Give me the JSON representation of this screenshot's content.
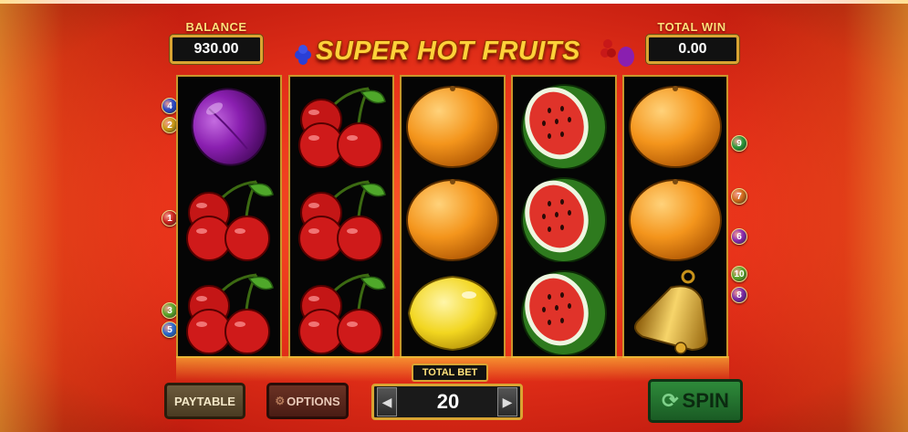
{
  "hud": {
    "balance_label": "BALANCE",
    "balance_value": "930.00",
    "total_win_label": "TOTAL WIN",
    "total_win_value": "0.00"
  },
  "logo": {
    "text": "SUPER HOT FRUITS"
  },
  "reels": [
    [
      "plum",
      "cherries",
      "cherries"
    ],
    [
      "cherries",
      "cherries",
      "cherries"
    ],
    [
      "orange",
      "orange",
      "lemon"
    ],
    [
      "watermelon",
      "watermelon",
      "watermelon"
    ],
    [
      "orange",
      "orange",
      "bell"
    ]
  ],
  "paylines": {
    "left": [
      "4",
      "2",
      "1",
      "3",
      "5"
    ],
    "right": [
      "9",
      "7",
      "6",
      "10",
      "8"
    ]
  },
  "controls": {
    "paytable_label": "PAYTABLE",
    "options_label": "OPTIONS",
    "total_bet_label": "TOTAL BET",
    "total_bet_value": "20",
    "spin_label": "SPIN"
  },
  "colors": {
    "frame_gold": "#d9a432",
    "background_red": "#e8321a",
    "spin_green": "#2e8a3a"
  }
}
